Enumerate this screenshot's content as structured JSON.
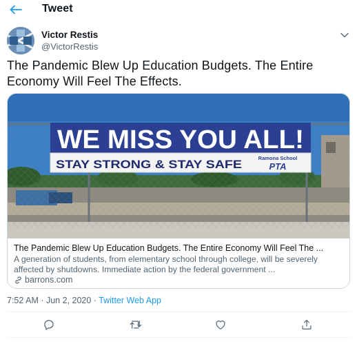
{
  "header": {
    "title": "Tweet",
    "back_icon": "arrow-left-icon",
    "accent": "#1d9bf0"
  },
  "author": {
    "name": "Victor Restis",
    "handle": "@VictorRestis"
  },
  "tweet": {
    "text": "The Pandemic Blew Up Education Budgets. The Entire Economy Will Feel The Effects."
  },
  "card": {
    "banner_main": "WE MISS YOU ALL!",
    "banner_sub": "STAY STRONG & STAY SAFE",
    "banner_school": "Ramona School",
    "banner_org": "PTA",
    "title": "The Pandemic Blew Up Education Budgets. The Entire Economy Will Feel The ...",
    "description": "A generation of students, from elementary school through college, will be severely affected by shutdowns. Immediate action by the federal government ...",
    "domain": "barrons.com"
  },
  "meta": {
    "time": "7:52 AM",
    "separator": " · ",
    "date": "Jun 2, 2020",
    "source": "Twitter Web App"
  },
  "actions": [
    "reply-icon",
    "retweet-icon",
    "like-icon",
    "share-icon"
  ]
}
